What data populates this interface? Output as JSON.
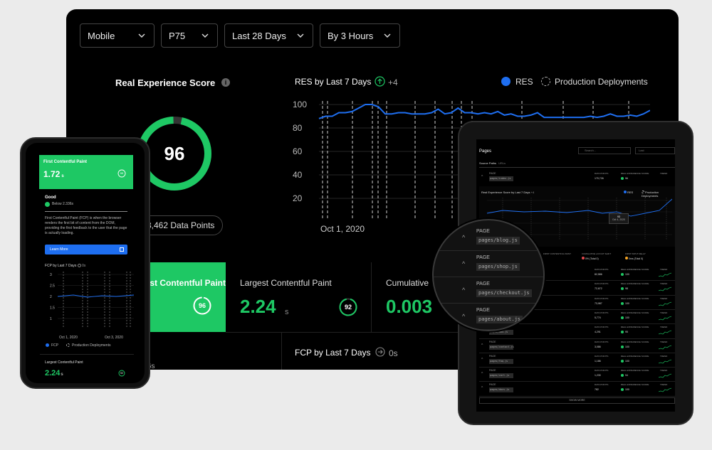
{
  "filters": {
    "device": "Mobile",
    "percentile": "P75",
    "range": "Last 28 Days",
    "granularity": "By 3 Hours"
  },
  "score": {
    "title": "Real Experience Score",
    "value": "96",
    "data_points": "3,462 Data Points"
  },
  "res_chart": {
    "title": "RES by Last 7 Days",
    "delta": "+4",
    "legend_res": "RES",
    "legend_deploy": "Production Deployments",
    "x_label": "Oct 1, 2020"
  },
  "chart_data": {
    "type": "line",
    "ylim": [
      20,
      100
    ],
    "yticks": [
      100,
      80,
      60,
      40,
      20
    ],
    "xlabel": "",
    "ylabel": "",
    "series": [
      {
        "name": "RES",
        "values": [
          88,
          90,
          90,
          93,
          93,
          94,
          97,
          100,
          100,
          98,
          92,
          92,
          93,
          93,
          92,
          92,
          92,
          93,
          96,
          92,
          93,
          97,
          93,
          93,
          92,
          93,
          92,
          94,
          91,
          92,
          90,
          90,
          91,
          93,
          89,
          89,
          89,
          89,
          89,
          89,
          89,
          90,
          89,
          90,
          92,
          90,
          90,
          91,
          90,
          92,
          95
        ]
      }
    ]
  },
  "metrics": {
    "fcp_label": "First Contentful Paint",
    "fcp_score": "96",
    "lcp_label": "Largest Contentful Paint",
    "lcp_value": "2.24",
    "lcp_unit": "s",
    "lcp_score": "92",
    "cls_label": "Cumulative",
    "cls_value": "0.003"
  },
  "fcp_chart": {
    "title": "FCP by Last 7 Days",
    "delta": "0s",
    "clipped": "2.36s"
  },
  "phone": {
    "fcp_title": "First Contentful Paint",
    "fcp_value": "1.72",
    "fcp_unit": "s",
    "fcp_score": "99",
    "good": "Good",
    "below": "Below 2.336s",
    "description": "First Contentful Paint (FCP) is when the browser renders the first bit of content from the DOM, providing the first feedback to the user that the page is actually loading.",
    "learn_more": "Learn More",
    "chart_title": "FCP by Last 7 Days",
    "chart_delta": "0s",
    "yticks": [
      "3",
      "2.5",
      "2",
      "1.5",
      "1"
    ],
    "x_start": "Oct 1, 2020",
    "x_end": "Oct 3, 2020",
    "legend_fcp": "FCP",
    "legend_deploy": "Production Deployments",
    "lcp_title": "Largest Contentful Paint",
    "lcp_value": "2.24",
    "lcp_unit": "s",
    "lcp_score": "92"
  },
  "tablet": {
    "title": "Pages",
    "search_placeholder": "Search...",
    "select": "Last",
    "tab_source": "Source Paths",
    "tab_urls": "URLs",
    "col_page": "PAGE",
    "col_data_points": "DATA POINTS",
    "col_res": "REAL EXPERIENCE SCORE",
    "col_trend": "TREND",
    "chart_title": "Real Experience Score by Last 7 Days",
    "chart_delta": "+4",
    "legend_res": "RES",
    "legend_deploy": "Production Deployments",
    "tooltip_score": "93",
    "tooltip_date": "Oct 4, 2020",
    "summary_fcp": "FIRST CONTENTFUL PAINT",
    "summary_cls": "CUMULATIVE LAYOUT SHIFT",
    "summary_fid": "FIRST INPUT DELAY",
    "summary_cls_val": "0% (Total 0)",
    "summary_fid_val": "0ms (Total 0)",
    "show_more": "SHOW MORE",
    "top_row": {
      "path": "pages/index.js",
      "dp": "170,726",
      "res": "96"
    },
    "rows": [
      {
        "path": "pages/blog.js",
        "dp": "82,586",
        "res": "100"
      },
      {
        "path": "pages/shop.js",
        "dp": "72,672",
        "res": "98"
      },
      {
        "path": "pages/checkout.js",
        "dp": "73,987",
        "res": "100"
      },
      {
        "path": "pages/about.js",
        "dp": "5,774",
        "res": "100"
      },
      {
        "path": "pages/404.js",
        "dp": "4,291",
        "res": "95"
      },
      {
        "path": "pages/contact.js",
        "dp": "3,086",
        "res": "100"
      },
      {
        "path": "pages/faq.js",
        "dp": "1,186",
        "res": "100"
      },
      {
        "path": "pages/cart.js",
        "dp": "1,230",
        "res": "94"
      },
      {
        "path": "pages/docs.js",
        "dp": "782",
        "res": "100"
      }
    ]
  },
  "magnifier": {
    "label": "PAGE",
    "rows": [
      {
        "path": "pages/blog.js"
      },
      {
        "path": "pages/shop.js"
      },
      {
        "path": "pages/checkout.js"
      },
      {
        "path": "pages/about.js"
      }
    ]
  },
  "colors": {
    "green": "#1ec864",
    "blue": "#1e6ef0",
    "background": "#000000"
  }
}
